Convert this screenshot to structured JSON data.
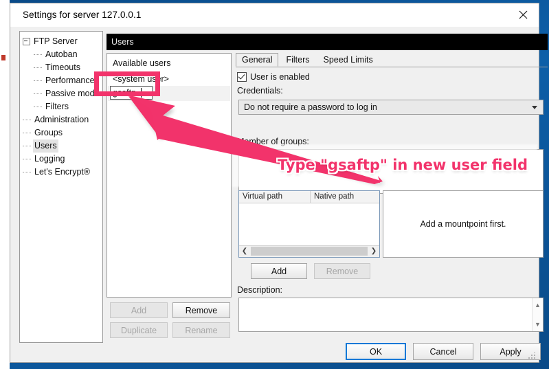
{
  "window": {
    "title": "Settings for server 127.0.0.1",
    "close_icon": "close-icon"
  },
  "tree": {
    "items": [
      {
        "label": "FTP Server",
        "level": 1,
        "expander": true,
        "selected": false
      },
      {
        "label": "Autoban",
        "level": 2,
        "expander": false,
        "selected": false
      },
      {
        "label": "Timeouts",
        "level": 2,
        "expander": false,
        "selected": false
      },
      {
        "label": "Performance",
        "level": 2,
        "expander": false,
        "selected": false
      },
      {
        "label": "Passive mode",
        "level": 2,
        "expander": false,
        "selected": false
      },
      {
        "label": "Filters",
        "level": 2,
        "expander": false,
        "selected": false
      },
      {
        "label": "Administration",
        "level": 1,
        "expander": false,
        "selected": false
      },
      {
        "label": "Groups",
        "level": 1,
        "expander": false,
        "selected": false
      },
      {
        "label": "Users",
        "level": 1,
        "expander": false,
        "selected": true
      },
      {
        "label": "Logging",
        "level": 1,
        "expander": false,
        "selected": false
      },
      {
        "label": "Let's Encrypt®",
        "level": 1,
        "expander": false,
        "selected": false
      }
    ]
  },
  "section": {
    "title": "Users"
  },
  "users_panel": {
    "header": "Available users",
    "existing_user": "<system user>",
    "new_user_value": "gsaftp",
    "buttons": {
      "add": "Add",
      "remove": "Remove",
      "duplicate": "Duplicate",
      "rename": "Rename"
    }
  },
  "detail": {
    "tabs": [
      {
        "label": "General",
        "active": true
      },
      {
        "label": "Filters",
        "active": false
      },
      {
        "label": "Speed Limits",
        "active": false
      }
    ],
    "user_enabled": {
      "label": "User is enabled",
      "checked": true
    },
    "credentials_label": "Credentials:",
    "credentials_value": "Do not require a password to log in",
    "groups_label": "Member of groups:",
    "mount_columns": {
      "virtual": "Virtual path",
      "native": "Native path"
    },
    "mount_note": "Add a mountpoint first.",
    "mount_buttons": {
      "add": "Add",
      "remove": "Remove"
    },
    "description_label": "Description:",
    "description_value": ""
  },
  "footer": {
    "ok": "OK",
    "cancel": "Cancel",
    "apply": "Apply"
  },
  "annotation": {
    "text": "Type \"gsaftp\" in new user field",
    "color": "#f2336b"
  }
}
